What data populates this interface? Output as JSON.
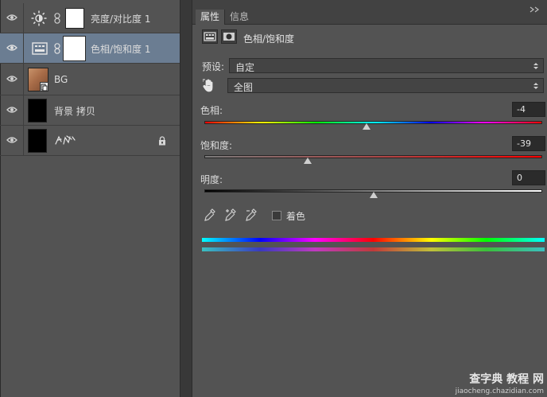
{
  "layers": [
    {
      "name": "亮度/对比度 1",
      "type": "adjustment",
      "icon": "brightness-contrast-icon",
      "selected": false
    },
    {
      "name": "色相/饱和度 1",
      "type": "adjustment",
      "icon": "hue-saturation-icon",
      "selected": true
    },
    {
      "name": "BG",
      "type": "image",
      "selected": false
    },
    {
      "name": "背景 拷贝",
      "type": "image",
      "selected": false
    },
    {
      "name": "",
      "type": "locked-background",
      "selected": false
    }
  ],
  "properties": {
    "tabs": [
      "属性",
      "信息"
    ],
    "title": "色相/饱和度",
    "preset_label": "预设:",
    "preset_value": "自定",
    "range_value": "全图",
    "hue": {
      "label": "色相:",
      "value": "-4",
      "position": 0.48
    },
    "saturation": {
      "label": "饱和度:",
      "value": "-39",
      "position": 0.305
    },
    "lightness": {
      "label": "明度:",
      "value": "0",
      "position": 0.5
    },
    "colorize_label": "着色",
    "colorize_checked": false
  },
  "watermark": {
    "line1": "查字典 教程 网",
    "line2": "jiaocheng.chazidian.com"
  }
}
